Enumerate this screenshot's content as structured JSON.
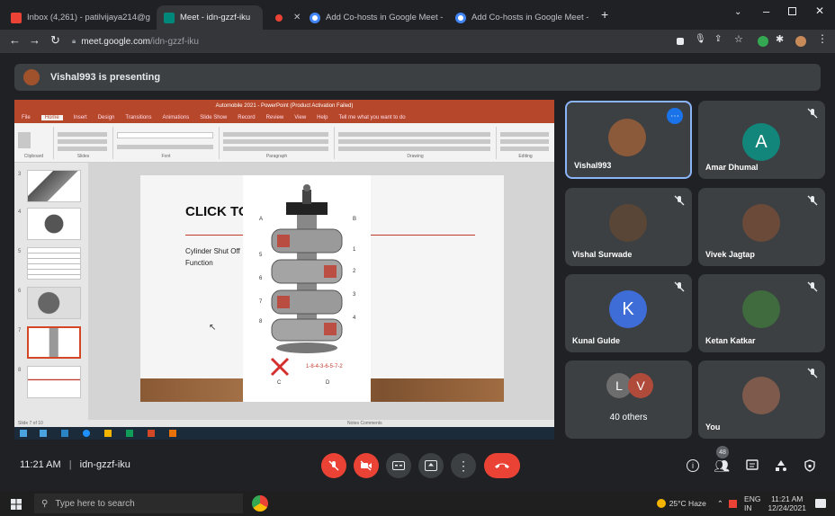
{
  "browser": {
    "tabs": [
      {
        "title": "Inbox (4,261) - patilvijaya214@g",
        "active": false,
        "favicon_color": "#ea4335"
      },
      {
        "title": "Meet - idn-gzzf-iku",
        "active": true,
        "favicon_color": "#00897b"
      },
      {
        "title": "",
        "active": false,
        "favicon_color": "#ea4335"
      },
      {
        "title": "Add Co-hosts in Google Meet - ",
        "active": false,
        "favicon_color": "#4285f4"
      },
      {
        "title": "Add Co-hosts in Google Meet - ",
        "active": false,
        "favicon_color": "#4285f4"
      }
    ],
    "url_host": "meet.google.com",
    "url_path": "/idn-gzzf-iku"
  },
  "meet": {
    "presenting_banner": "Vishal993 is presenting",
    "meeting_code": "idn-gzzf-iku",
    "time": "11:21 AM",
    "separator": "|",
    "participant_count_badge": "48",
    "shared_screen": {
      "window_title": "Automobile 2021 - PowerPoint (Product Activation Failed)",
      "ribbon_tabs": [
        "File",
        "Home",
        "Insert",
        "Design",
        "Transitions",
        "Animations",
        "Slide Show",
        "Record",
        "Review",
        "View",
        "Help",
        "Tell me what you want to do"
      ],
      "ribbon_groups": [
        "Clipboard",
        "Slides",
        "Font",
        "Paragraph",
        "Drawing",
        "Editing"
      ],
      "thumb_numbers": [
        "3",
        "4",
        "5",
        "6",
        "7",
        "8"
      ],
      "slide_title": "CLICK TO",
      "slide_bullets": "Cylinder Shut Off Function",
      "engine_labels": [
        "A",
        "B",
        "1",
        "2",
        "3",
        "4",
        "5",
        "6",
        "7",
        "8",
        "C",
        "D"
      ],
      "engine_caption": "1-8-4-3-6-5-7-2",
      "status_left": "Slide 7 of 10",
      "status_right": "Notes  Comments"
    },
    "tiles": [
      {
        "name": "Vishal993",
        "type": "photo",
        "color": "#8a5a3a",
        "speaking": true,
        "muted": false
      },
      {
        "name": "Amar Dhumal",
        "type": "letter",
        "letter": "A",
        "color": "#12867a",
        "muted": true
      },
      {
        "name": "Vishal Surwade",
        "type": "photo",
        "color": "#5a4636",
        "muted": true
      },
      {
        "name": "Vivek Jagtap",
        "type": "photo",
        "color": "#6b4a3a",
        "muted": true
      },
      {
        "name": "Kunal Gulde",
        "type": "letter",
        "letter": "K",
        "color": "#3f6dd8",
        "muted": true
      },
      {
        "name": "Ketan Katkar",
        "type": "photo",
        "color": "#3f6b3f",
        "muted": true
      },
      {
        "name": "40 others",
        "type": "others",
        "letters": [
          "L",
          "V"
        ],
        "colors": [
          "#6d6d6d",
          "#b04a3a"
        ],
        "muted": false
      },
      {
        "name": "You",
        "type": "photo",
        "color": "#7e5a4c",
        "muted": true
      }
    ]
  },
  "taskbar": {
    "search_placeholder": "Type here to search",
    "weather": "25°C  Haze",
    "lang": "ENG",
    "region": "IN",
    "time": "11:21 AM",
    "date": "12/24/2021"
  },
  "colors": {
    "meet_bg": "#202124",
    "tile_bg": "#3c4043",
    "danger": "#ea4335",
    "accent": "#8ab4f8",
    "powerpoint": "#b7472a"
  }
}
